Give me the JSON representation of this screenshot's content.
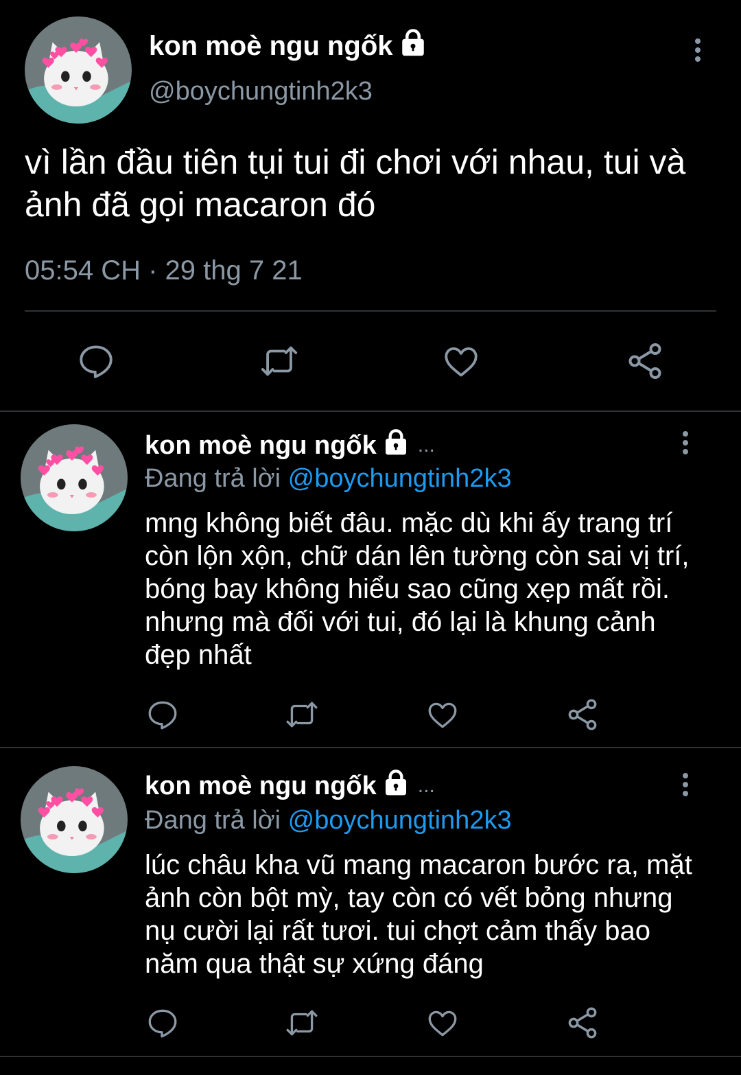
{
  "main_tweet": {
    "display_name": "kon moè ngu ngốk",
    "handle": "@boychungtinh2k3",
    "text": "vì lần đầu tiên tụi tui đi chơi với nhau, tui và ảnh đã gọi macaron đó",
    "timestamp": "05:54 CH · 29 thg 7 21",
    "lock_icon": "lock-icon",
    "more_icon": "more-vertical-icon"
  },
  "replies": [
    {
      "display_name": "kon moè ngu ngốk",
      "ellipsis": "...",
      "replying_prefix": "Đang trả lời",
      "replying_to": "@boychungtinh2k3",
      "text": "mng không biết đâu. mặc dù khi ấy trang trí còn lộn xộn, chữ dán lên tường còn sai vị trí, bóng bay không hiểu sao cũng xẹp mất rồi. nhưng mà đối với tui, đó lại là khung cảnh đẹp nhất"
    },
    {
      "display_name": "kon moè ngu ngốk",
      "ellipsis": "...",
      "replying_prefix": "Đang trả lời",
      "replying_to": "@boychungtinh2k3",
      "text": "lúc châu kha vũ mang macaron bước ra, mặt ảnh còn bột mỳ, tay còn có vết bỏng nhưng nụ cười lại rất tươi. tui chợt cảm thấy bao năm qua thật sự xứng đáng"
    }
  ],
  "action_icons": [
    "reply-icon",
    "retweet-icon",
    "like-icon",
    "share-icon"
  ],
  "colors": {
    "background": "#000000",
    "text": "#ffffff",
    "secondary": "#8b98a5",
    "link": "#1d9bf0",
    "divider": "#2f3336"
  }
}
